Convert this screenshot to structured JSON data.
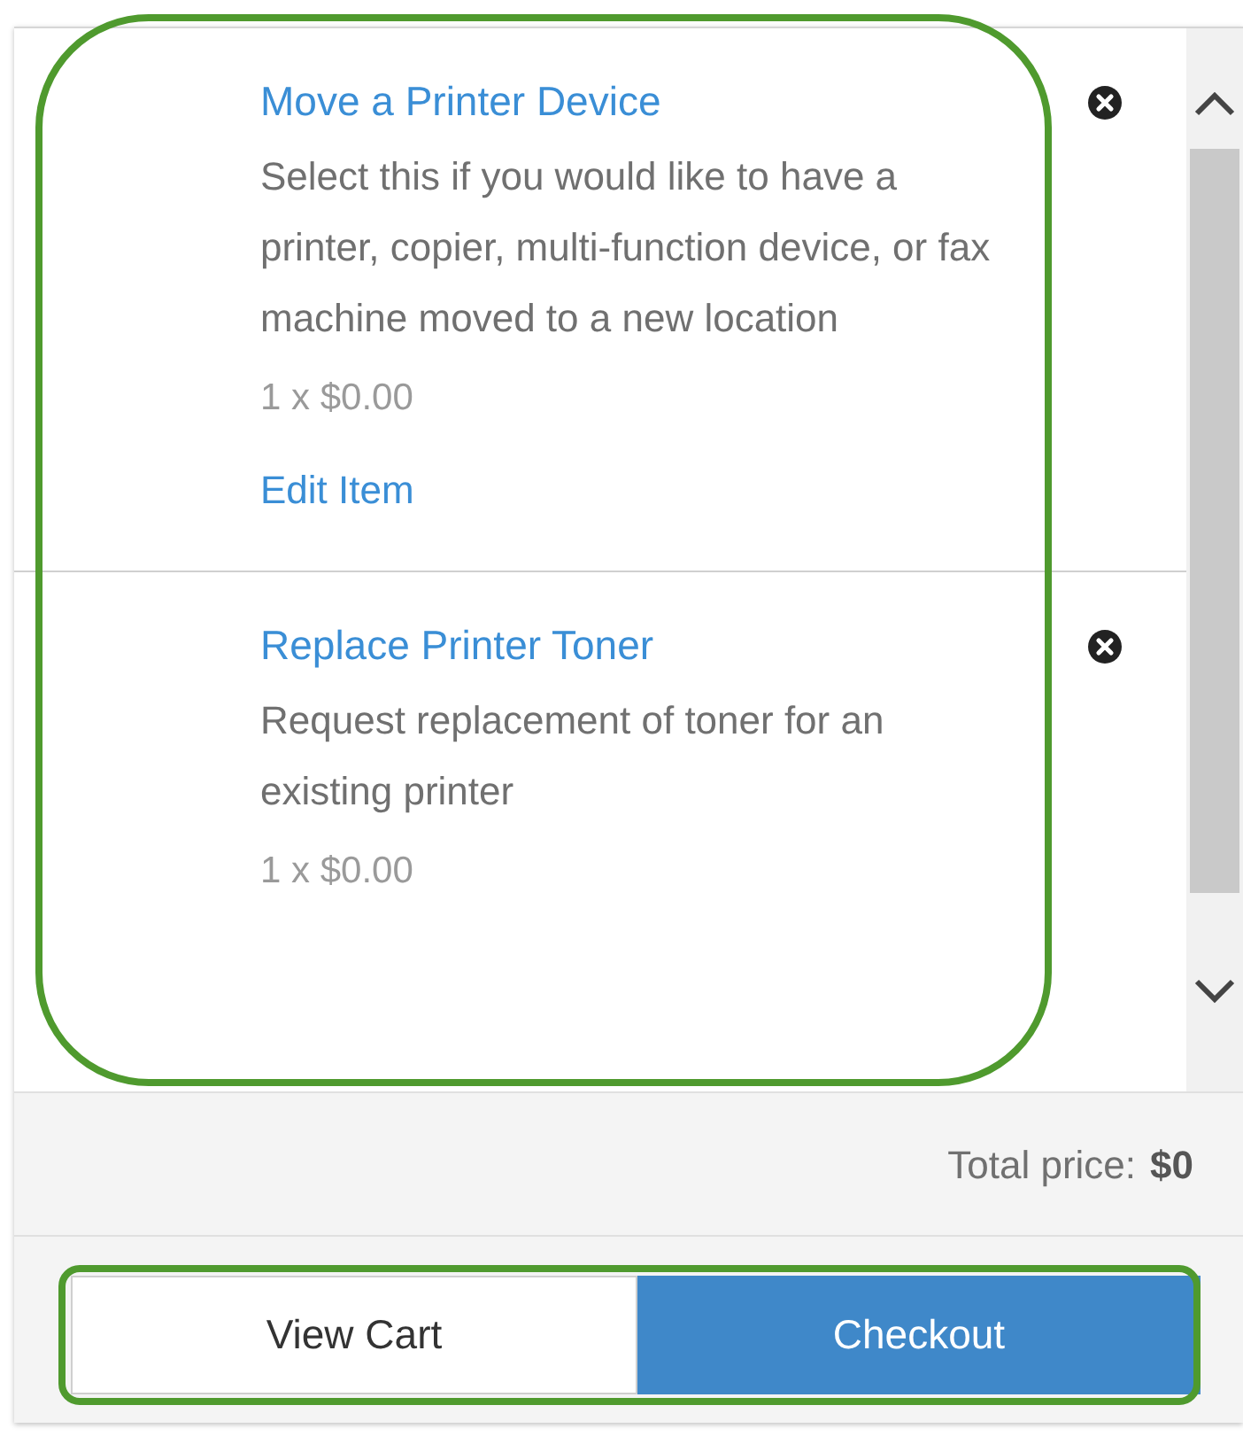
{
  "cart_items": [
    {
      "title": "Move a Printer Device",
      "description": "Select this if you would like to have a printer, copier, multi-function device, or fax machine moved to a new location",
      "price": "1 x $0.00",
      "edit_link": "Edit Item"
    },
    {
      "title": "Replace Printer Toner",
      "description": "Request replacement of toner for an existing printer",
      "price": "1 x $0.00"
    }
  ],
  "total": {
    "label": "Total price:",
    "value": "$0"
  },
  "buttons": [
    {
      "label": "View Cart",
      "kind": "secondary"
    },
    {
      "label": "Checkout",
      "kind": "primary"
    }
  ]
}
